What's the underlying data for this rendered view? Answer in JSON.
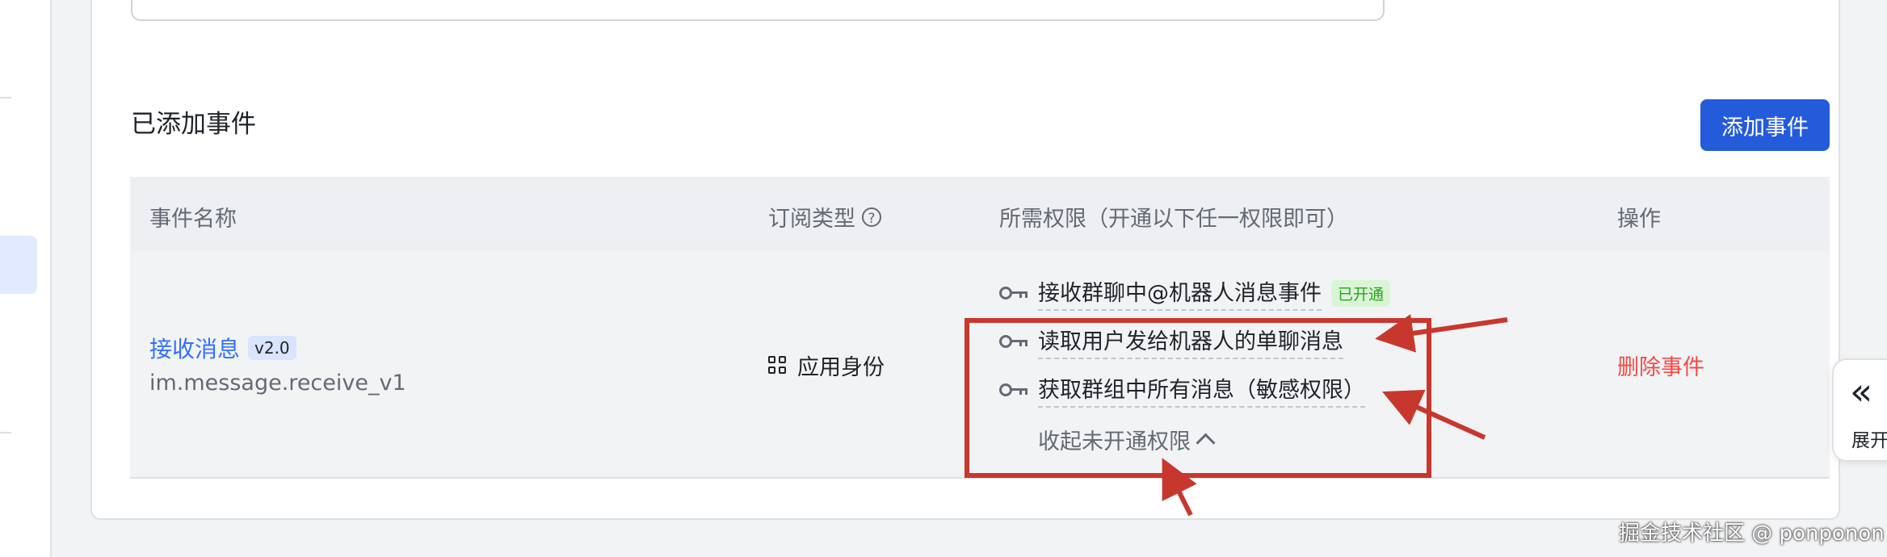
{
  "section": {
    "title": "已添加事件",
    "add_button": "添加事件"
  },
  "table": {
    "headers": {
      "event_name": "事件名称",
      "subscription_type": "订阅类型",
      "permissions": "所需权限（开通以下任一权限即可）",
      "actions": "操作"
    },
    "help_icon_glyph": "?",
    "row": {
      "event_name": "接收消息",
      "version": "v2.0",
      "event_key": "im.message.receive_v1",
      "subscription_type": "应用身份",
      "permissions": [
        {
          "label": "接收群聊中@机器人消息事件",
          "status": "已开通"
        },
        {
          "label": "读取用户发给机器人的单聊消息"
        },
        {
          "label": "获取群组中所有消息（敏感权限）"
        }
      ],
      "collapse_label": "收起未开通权限",
      "delete_label": "删除事件"
    }
  },
  "side_tab": {
    "glyph": "«",
    "label": "展开"
  },
  "watermark": "掘金技术社区 @ ponponon",
  "colors": {
    "primary": "#245bdb",
    "link": "#3370ff",
    "danger": "#f54a45",
    "granted": "#2ea121",
    "annotation": "#c8372d"
  }
}
